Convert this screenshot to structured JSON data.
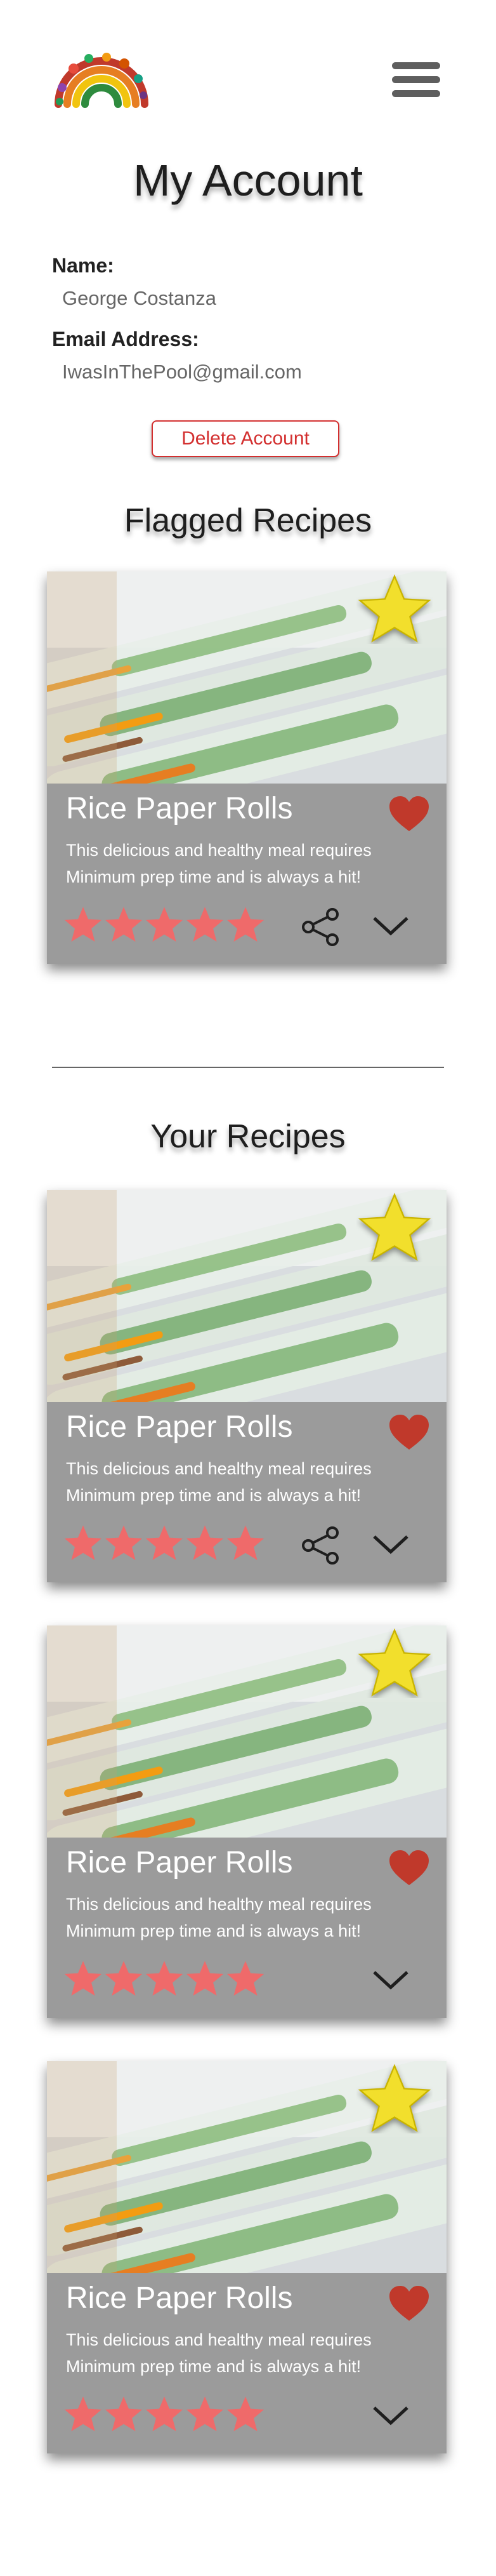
{
  "header": {
    "logo_icon": "vegetable-rainbow-logo",
    "menu_icon": "hamburger-menu-icon"
  },
  "page_title": "My Account",
  "account": {
    "name_label": "Name:",
    "name_value": "George  Costanza",
    "email_label": "Email Address:",
    "email_value": "IwasInThePool@gmail.com",
    "delete_label": "Delete Account"
  },
  "flagged": {
    "heading": "Flagged Recipes",
    "cards": [
      {
        "title": "Rice Paper Rolls",
        "desc_line1": "This delicious and healthy meal requires",
        "desc_line2": "Minimum prep time and is always a hit!",
        "rating": 5,
        "share": true
      }
    ]
  },
  "yours": {
    "heading": "Your Recipes",
    "cards": [
      {
        "title": "Rice Paper Rolls",
        "desc_line1": "This delicious and healthy meal requires",
        "desc_line2": "Minimum prep time and is always a hit!",
        "rating": 5,
        "share": true
      },
      {
        "title": "Rice Paper Rolls",
        "desc_line1": "This delicious and healthy meal requires",
        "desc_line2": "Minimum prep time and is always a hit!",
        "rating": 5,
        "share": false
      },
      {
        "title": "Rice Paper Rolls",
        "desc_line1": "This delicious and healthy meal requires",
        "desc_line2": "Minimum prep time and is always a hit!",
        "rating": 5,
        "share": false
      }
    ]
  },
  "colors": {
    "card_bg": "#9b9b9b",
    "star_badge": "#f2df2c",
    "heart": "#c0392b",
    "rating_star": "#ef6a6a",
    "delete_accent": "#d32f2f"
  }
}
